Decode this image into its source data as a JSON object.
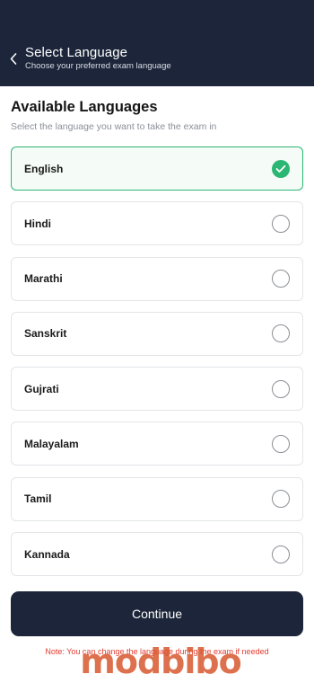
{
  "header": {
    "title": "Select Language",
    "subtitle": "Choose your preferred exam language"
  },
  "section": {
    "title": "Available Languages",
    "subtitle": "Select the language you want to take the exam in"
  },
  "languages": [
    {
      "label": "English",
      "selected": true
    },
    {
      "label": "Hindi",
      "selected": false
    },
    {
      "label": "Marathi",
      "selected": false
    },
    {
      "label": "Sanskrit",
      "selected": false
    },
    {
      "label": "Gujrati",
      "selected": false
    },
    {
      "label": "Malayalam",
      "selected": false
    },
    {
      "label": "Tamil",
      "selected": false
    },
    {
      "label": "Kannada",
      "selected": false
    }
  ],
  "continue_label": "Continue",
  "note": "Note: You can change the language during the exam if needed",
  "watermark": "modbibo",
  "colors": {
    "header_bg": "#1c2539",
    "accent_green": "#2bb673",
    "note_red": "#e23b2e",
    "watermark": "#d8582e"
  },
  "icons": {
    "back": "chevron-left-icon",
    "selected": "check-circle-icon",
    "unselected": "radio-empty-icon"
  }
}
